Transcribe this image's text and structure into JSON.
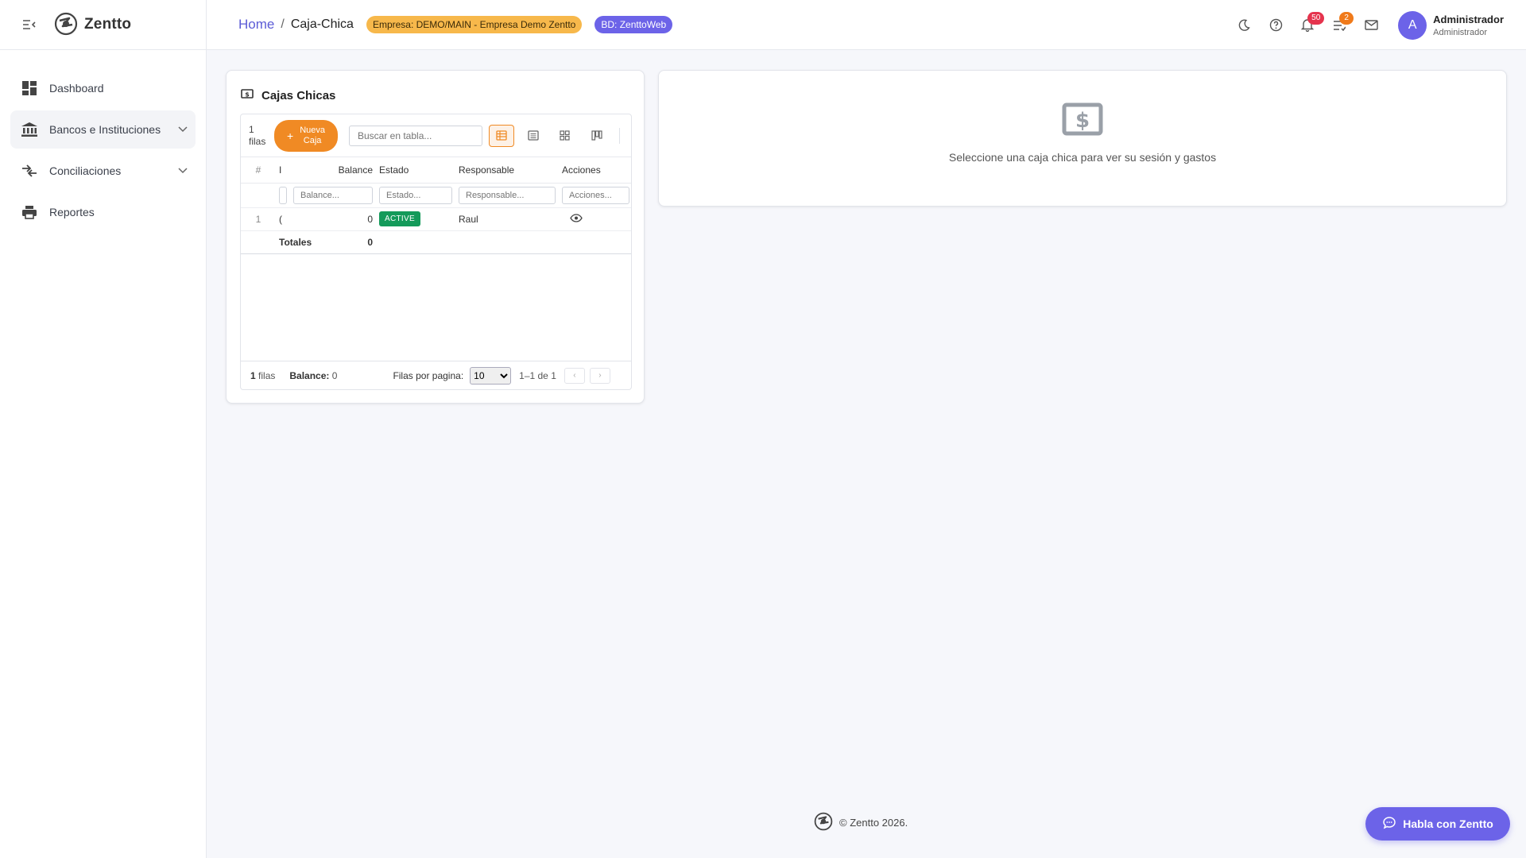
{
  "brand": {
    "name": "Zentto",
    "logo_icon": "zentto-logo-icon",
    "menu_icon": "menu-collapse-icon"
  },
  "sidebar": {
    "items": [
      {
        "label": "Dashboard",
        "icon": "dashboard-icon",
        "expandable": false
      },
      {
        "label": "Bancos e Instituciones",
        "icon": "bank-icon",
        "expandable": true,
        "active": true
      },
      {
        "label": "Conciliaciones",
        "icon": "compare-arrows-icon",
        "expandable": true
      },
      {
        "label": "Reportes",
        "icon": "printer-icon",
        "expandable": false
      }
    ]
  },
  "header": {
    "breadcrumb_home": "Home",
    "breadcrumb_sep": "/",
    "breadcrumb_current": "Caja-Chica",
    "empresa_badge": "Empresa: DEMO/MAIN - Empresa Demo Zentto",
    "bd_badge": "BD: ZenttoWeb",
    "notifications_count": "50",
    "tasks_count": "2",
    "user": {
      "initial": "A",
      "name": "Administrador",
      "role": "Administrador"
    },
    "colors": {
      "accent": "#6c63e8",
      "empresa_badge": "#f7b84b",
      "notif_badge": "#e5334d",
      "tasks_badge": "#f07a1a"
    }
  },
  "cajas": {
    "title": "Cajas Chicas",
    "toolbar": {
      "row_count": "1",
      "row_count_unit": "filas",
      "new_button_line1": "Nueva",
      "new_button_line2": "Caja",
      "new_button_plus": "+",
      "search_placeholder": "Buscar en tabla..."
    },
    "columns": [
      "#",
      "I",
      "Balance",
      "Estado",
      "Responsable",
      "Acciones"
    ],
    "filters": {
      "balance": "Balance...",
      "estado": "Estado...",
      "responsable": "Responsable...",
      "acciones": "Acciones..."
    },
    "rows": [
      {
        "index": "1",
        "name": "(",
        "balance": "0",
        "estado": "ACTIVE",
        "responsable": "Raul"
      }
    ],
    "totals": {
      "label": "Totales",
      "balance": "0"
    },
    "footer": {
      "rows_count": "1",
      "rows_unit": "filas",
      "balance_label": "Balance:",
      "balance_value": "0",
      "per_page_label": "Filas por pagina:",
      "per_page_value": "10",
      "range": "1–1 de 1",
      "prev": "‹",
      "next": "›"
    },
    "colors": {
      "primary_button": "#f08a24",
      "status_active": "#149a5a"
    }
  },
  "detail": {
    "empty_icon": "dollar-bill-icon",
    "empty_text": "Seleccione una caja chica para ver su sesión y gastos"
  },
  "footer": {
    "text": "© Zentto 2026."
  },
  "chat": {
    "label": "Habla con Zentto",
    "icon": "chat-bubble-icon"
  }
}
